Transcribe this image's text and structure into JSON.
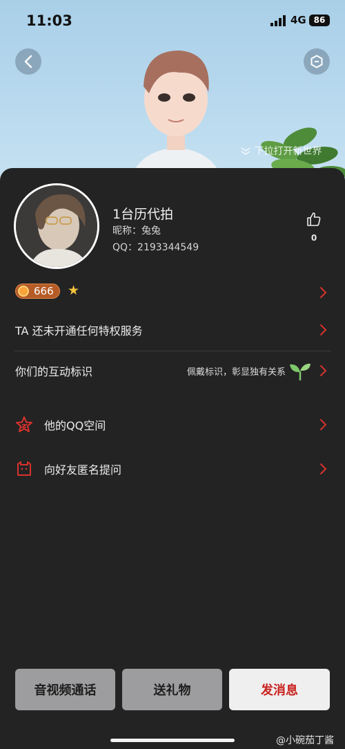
{
  "status": {
    "time": "11:03",
    "network": "4G",
    "battery": "86"
  },
  "hero": {
    "pulldown_hint": "下拉打开新世界"
  },
  "profile": {
    "name": "1台历代拍",
    "nickname_label": "昵称：兔兔",
    "qq_label": "QQ：2193344549",
    "likes": "0",
    "level": "666"
  },
  "rows": {
    "privilege": "TA 还未开通任何特权服务",
    "interaction_title": "你们的互动标识",
    "interaction_hint": "佩戴标识，彰显独有关系",
    "qzone": "他的QQ空间",
    "anon_question": "向好友匿名提问"
  },
  "buttons": {
    "call": "音视频通话",
    "gift": "送礼物",
    "message": "发消息"
  },
  "watermark": "@小碗茄丁酱",
  "colors": {
    "accent_red": "#c9221e",
    "chevron": "#d9322c",
    "sprout": "#7fc86a"
  }
}
